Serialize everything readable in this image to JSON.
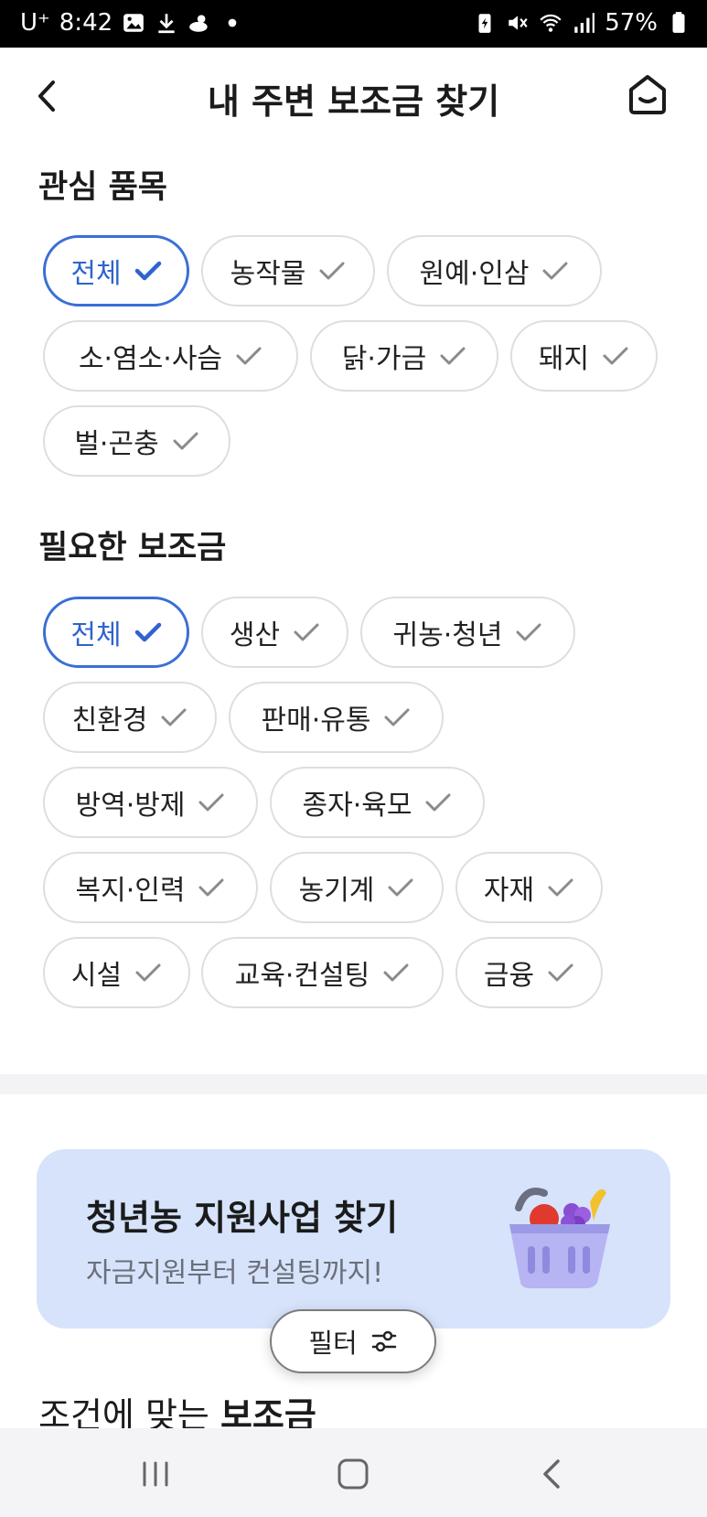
{
  "status_bar": {
    "carrier": "U⁺",
    "time": "8:42",
    "battery": "57%"
  },
  "header": {
    "title": "내 주변 보조금 찾기"
  },
  "interest_section": {
    "title": "관심 품목",
    "chips": [
      {
        "label": "전체",
        "selected": true
      },
      {
        "label": "농작물",
        "selected": false
      },
      {
        "label": "원예·인삼",
        "selected": false
      },
      {
        "label": "소·염소·사슴",
        "selected": false
      },
      {
        "label": "닭·가금",
        "selected": false
      },
      {
        "label": "돼지",
        "selected": false
      },
      {
        "label": "벌·곤충",
        "selected": false
      }
    ]
  },
  "subsidy_section": {
    "title": "필요한 보조금",
    "chips": [
      {
        "label": "전체",
        "selected": true
      },
      {
        "label": "생산",
        "selected": false
      },
      {
        "label": "귀농·청년",
        "selected": false
      },
      {
        "label": "친환경",
        "selected": false
      },
      {
        "label": "판매·유통",
        "selected": false
      },
      {
        "label": "방역·방제",
        "selected": false
      },
      {
        "label": "종자·육모",
        "selected": false
      },
      {
        "label": "복지·인력",
        "selected": false
      },
      {
        "label": "농기계",
        "selected": false
      },
      {
        "label": "자재",
        "selected": false
      },
      {
        "label": "시설",
        "selected": false
      },
      {
        "label": "교육·컨설팅",
        "selected": false
      },
      {
        "label": "금융",
        "selected": false
      }
    ]
  },
  "banner": {
    "title": "청년농 지원사업 찾기",
    "subtitle": "자금지원부터 컨설팅까지!"
  },
  "filter_button": {
    "label": "필터"
  },
  "results": {
    "title_prefix": "조건에 맞는 ",
    "title_bold": "보조금"
  },
  "colors": {
    "accent": "#3a6fd6",
    "banner_bg": "#d6e3fb",
    "check_gray": "#8a8a8a"
  }
}
